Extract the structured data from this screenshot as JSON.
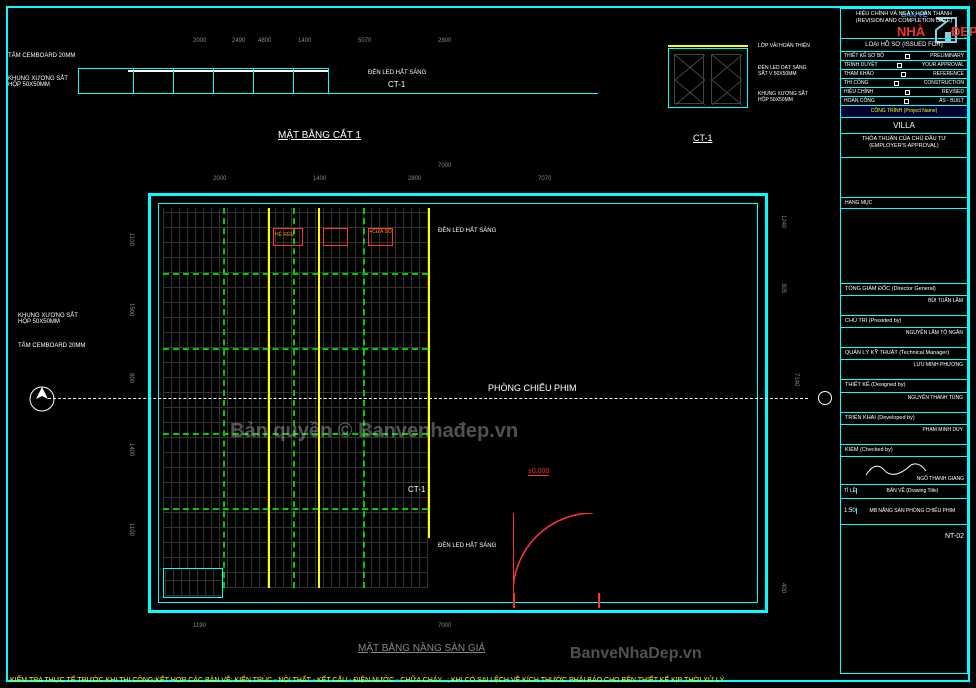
{
  "titleblock": {
    "rev_head": "HIỆU CHỈNH VÀ NGÀY HOÀN THÀNH\n(REVISION AND COMPLETION DATE)",
    "issue_head": "LOẠI HỒ SƠ\n(ISSUED FOR)",
    "rows": [
      {
        "l": "THIẾT KẾ SƠ BỘ",
        "r": "PRELIMINARY"
      },
      {
        "l": "TRÌNH DUYỆT",
        "r": "YOUR APPROVAL"
      },
      {
        "l": "THAM KHẢO",
        "r": "REFERENCE"
      },
      {
        "l": "THI CÔNG",
        "r": "CONSTRUCTION"
      },
      {
        "l": "HIỆU CHỈNH",
        "r": "REVISED"
      },
      {
        "l": "HOÀN CÔNG",
        "r": "AS - BUILT"
      }
    ],
    "proj_lbl": "CÔNG TRÌNH (Project Name)",
    "proj": "VILLA",
    "approval": "THỎA THUẬN CỦA CHỦ ĐẦU TƯ\n(EMPLOYER'S APPROVAL)",
    "item_lbl": "HẠNG MỤC",
    "gd_lbl": "TỔNG GIÁM ĐỐC (Director General)",
    "gd_name": "BÙI TUẤN LÂM",
    "ct_lbl": "CHỦ TRÌ (Presided by)",
    "ct_name": "NGUYỄN LÂM TỐ NGÂN",
    "ql_lbl": "QUẢN LÝ KỸ THUẬT\n(Technical Manager)",
    "ql_name": "LƯU MINH PHƯƠNG",
    "tk_lbl": "THIẾT KẾ (Designed by)",
    "tk_name": "NGUYỄN THANH TÙNG",
    "tr_lbl": "TRIỂN KHAI (Developed by)",
    "tr_name": "PHẠM MINH DUY",
    "km_lbl": "KIỂM (Checked by)",
    "km_name": "NGÔ THANH GIANG",
    "scale_lbl": "TỈ LỆ",
    "scale": "1:50",
    "dwg_lbl": "BẢN VẼ (Drawing Title)",
    "dwg": "MB NÂNG SÀN PHÒNG CHIẾU PHIM",
    "sheet": "NT-02"
  },
  "section1": {
    "title": "MẶT BẰNG CẮT 1",
    "tag": "CT-1",
    "notes": {
      "cemboard": "TẤM CEMBOARD 20MM",
      "khung": "KHUNG XƯƠNG SẮT\nHỘP 50X50MM",
      "led": "ĐÈN LED HẮT SÁNG"
    },
    "dims": {
      "d1": "2000",
      "d2": "1400",
      "d3": "2800",
      "d4": "4800",
      "d5": "5070",
      "d6": "2490"
    }
  },
  "detail": {
    "tag": "CT-1",
    "notes": {
      "lop": "LỚP VẢI HOÀN THIỆN",
      "led": "ĐÈN LED DẠT SÁNG\nSẮT V 50X50MM",
      "khung": "KHUNG XƯƠNG SẮT\nHỘP 50X50MM"
    }
  },
  "plan": {
    "title": "MẶT BẰNG NÂNG SÀN GIẢ",
    "room": "PHÒNG CHIẾU PHIM",
    "level": "±0.000",
    "tag": "CT-1",
    "notes": {
      "cemboard": "TẤM CEMBOARD 20MM",
      "khung": "KHUNG XƯƠNG SẮT\nHỘP 50X50MM",
      "led": "ĐÈN LED HẮT SÁNG",
      "rem": "HỆ RÈM",
      "cua": "+CỬA SỔ"
    },
    "dims": {
      "w1": "2000",
      "w2": "1400",
      "w3": "2800",
      "w4": "7070",
      "w5": "7000",
      "w6": "1190",
      "h1": "1100",
      "h2": "1500",
      "h3": "800",
      "h4": "1400",
      "h5": "1100",
      "h6": "1240",
      "h7": "305",
      "htot": "7140",
      "h8": "400"
    }
  },
  "footer": "KIỂM TRA THỰC TẾ TRƯỚC KHI THI CÔNG;KẾT HỢP CÁC BẢN VẼ: KIẾN TRÚC - NỘI THẤT - KẾT CẤU - ĐIỆN NƯỚC - CHỮA CHÁY...; KHI CÓ SAI LỆCH VỀ KÍCH THƯỚC PHẢI BÁO CHO BÊN THIẾT KẾ KỊP THỜI XỬ LÝ.",
  "watermarks": {
    "w1": "Bản quyền © Banvenhađep.vn",
    "w2": "BanveNhaDep.vn"
  },
  "logo": {
    "l1": "BẢN VẼ",
    "l2": "NHÀ",
    "l3": "ĐẸP"
  }
}
